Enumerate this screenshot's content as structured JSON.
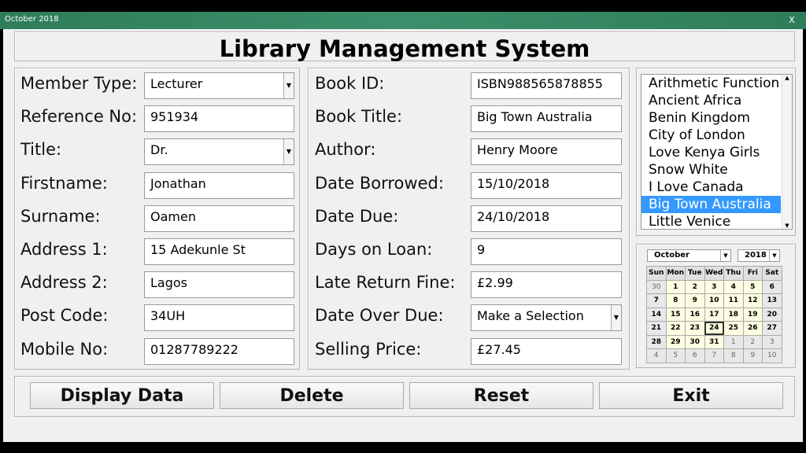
{
  "window": {
    "title": "October 2018",
    "close": "X"
  },
  "header": {
    "title": "Library Management System"
  },
  "member": [
    {
      "label": "Member Type:",
      "value": "Lecturer",
      "dropdown": true
    },
    {
      "label": "Reference No:",
      "value": "951934"
    },
    {
      "label": "Title:",
      "value": "Dr.",
      "dropdown": true
    },
    {
      "label": "Firstname:",
      "value": "Jonathan"
    },
    {
      "label": "Surname:",
      "value": "Oamen"
    },
    {
      "label": "Address 1:",
      "value": "15 Adekunle St"
    },
    {
      "label": "Address 2:",
      "value": "Lagos"
    },
    {
      "label": "Post Code:",
      "value": "34UH"
    },
    {
      "label": "Mobile No:",
      "value": "01287789222"
    }
  ],
  "book": [
    {
      "label": "Book ID:",
      "value": "ISBN988565878855"
    },
    {
      "label": "Book Title:",
      "value": "Big Town Australia"
    },
    {
      "label": "Author:",
      "value": "Henry Moore"
    },
    {
      "label": "Date Borrowed:",
      "value": "15/10/2018"
    },
    {
      "label": "Date Due:",
      "value": "24/10/2018"
    },
    {
      "label": "Days on Loan:",
      "value": "9"
    },
    {
      "label": "Late Return Fine:",
      "value": "£2.99"
    },
    {
      "label": "Date Over Due:",
      "value": "Make a Selection",
      "dropdown": true
    },
    {
      "label": "Selling Price:",
      "value": "£27.45"
    }
  ],
  "book_list": {
    "items": [
      "Arithmetic Function",
      "Ancient Africa",
      "Benin Kingdom",
      "City of London",
      "Love Kenya Girls",
      "Snow White",
      "I Love Canada",
      "Big Town Australia",
      "Little Venice"
    ],
    "selected": "Big Town Australia"
  },
  "calendar": {
    "month": "October",
    "year": "2018",
    "days": [
      "Sun",
      "Mon",
      "Tue",
      "Wed",
      "Thu",
      "Fri",
      "Sat"
    ],
    "weeks": [
      [
        "30",
        "1",
        "2",
        "3",
        "4",
        "5",
        "6"
      ],
      [
        "7",
        "8",
        "9",
        "10",
        "11",
        "12",
        "13"
      ],
      [
        "14",
        "15",
        "16",
        "17",
        "18",
        "19",
        "20"
      ],
      [
        "21",
        "22",
        "23",
        "24",
        "25",
        "26",
        "27"
      ],
      [
        "28",
        "29",
        "30",
        "31",
        "1",
        "2",
        "3"
      ],
      [
        "4",
        "5",
        "6",
        "7",
        "8",
        "9",
        "10"
      ]
    ],
    "selected_day": "24"
  },
  "buttons": {
    "display": "Display Data",
    "delete": "Delete",
    "reset": "Reset",
    "exit": "Exit"
  }
}
